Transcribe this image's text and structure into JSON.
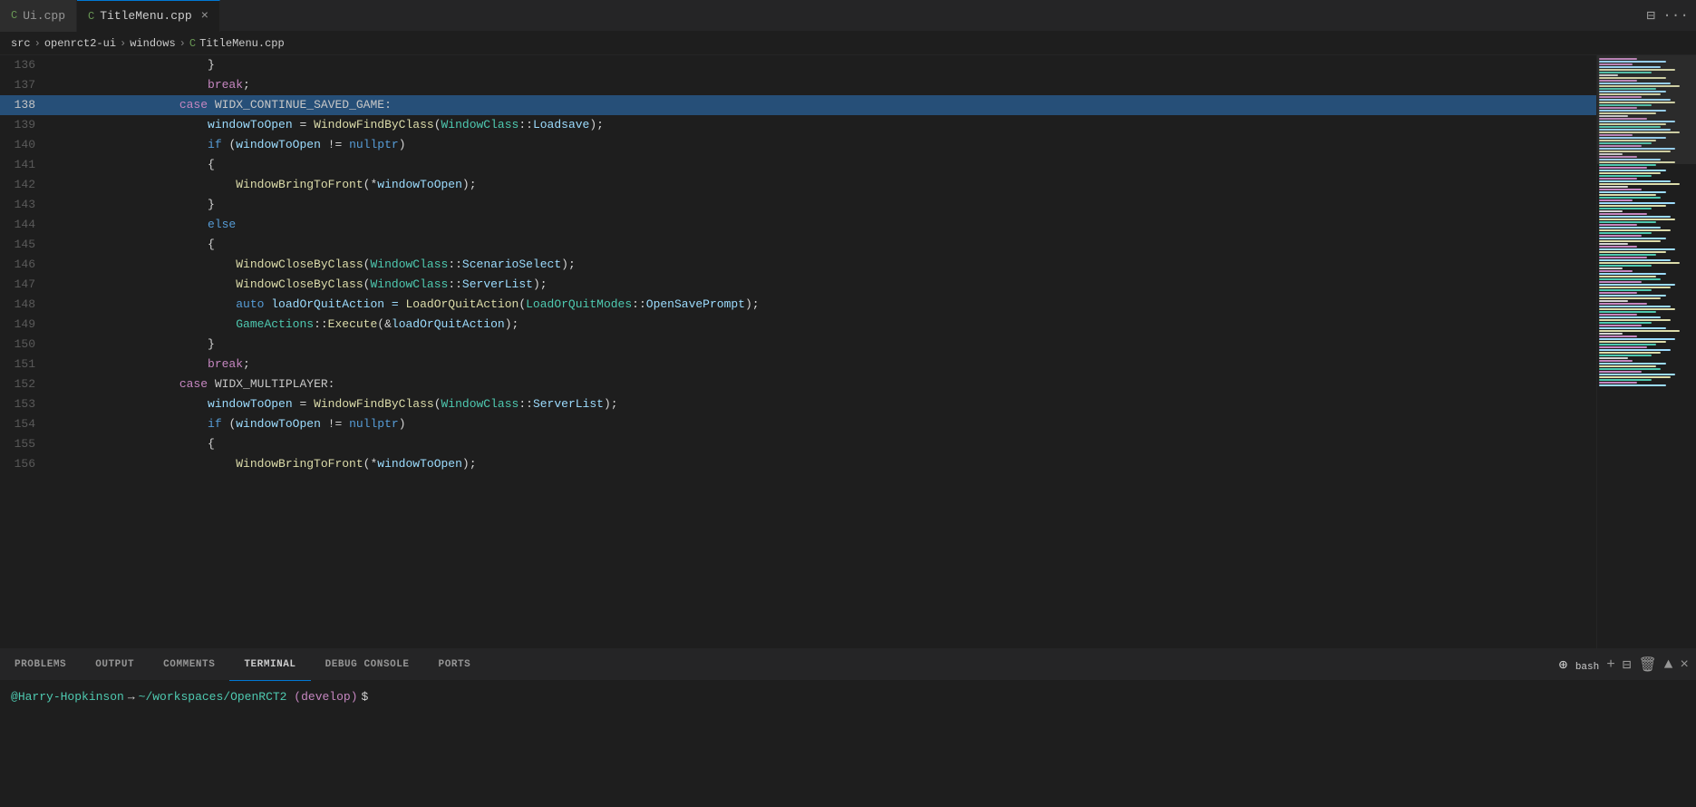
{
  "tabs": [
    {
      "id": "ui-cpp",
      "icon": "C",
      "label": "Ui.cpp",
      "active": false,
      "modified": false
    },
    {
      "id": "titlemenu-cpp",
      "icon": "C",
      "label": "TitleMenu.cpp",
      "active": true,
      "modified": false
    }
  ],
  "breadcrumb": {
    "parts": [
      "src",
      "openrct2-ui",
      "windows",
      "TitleMenu.cpp"
    ]
  },
  "lines": [
    {
      "num": 136,
      "active": false,
      "content": [
        {
          "t": "                    }",
          "c": "punct"
        }
      ]
    },
    {
      "num": 137,
      "active": false,
      "content": [
        {
          "t": "                    ",
          "c": "plain"
        },
        {
          "t": "break",
          "c": "kw"
        },
        {
          "t": ";",
          "c": "punct"
        }
      ]
    },
    {
      "num": 138,
      "active": true,
      "content": [
        {
          "t": "                ",
          "c": "plain"
        },
        {
          "t": "case",
          "c": "kw"
        },
        {
          "t": " WIDX_CONTINUE_SAVED_GAME:",
          "c": "macro"
        }
      ]
    },
    {
      "num": 139,
      "active": false,
      "content": [
        {
          "t": "                    ",
          "c": "plain"
        },
        {
          "t": "windowToOpen",
          "c": "var"
        },
        {
          "t": " = ",
          "c": "op"
        },
        {
          "t": "WindowFindByClass",
          "c": "fn"
        },
        {
          "t": "(",
          "c": "punct"
        },
        {
          "t": "WindowClass",
          "c": "cls"
        },
        {
          "t": "::",
          "c": "op"
        },
        {
          "t": "Loadsave",
          "c": "var"
        },
        {
          "t": ");",
          "c": "punct"
        }
      ]
    },
    {
      "num": 140,
      "active": false,
      "content": [
        {
          "t": "                    ",
          "c": "plain"
        },
        {
          "t": "if",
          "c": "kw2"
        },
        {
          "t": " (",
          "c": "punct"
        },
        {
          "t": "windowToOpen",
          "c": "var"
        },
        {
          "t": " != ",
          "c": "op"
        },
        {
          "t": "nullptr",
          "c": "kw2"
        },
        {
          "t": ")",
          "c": "punct"
        }
      ]
    },
    {
      "num": 141,
      "active": false,
      "content": [
        {
          "t": "                    {",
          "c": "punct"
        }
      ]
    },
    {
      "num": 142,
      "active": false,
      "content": [
        {
          "t": "                        ",
          "c": "plain"
        },
        {
          "t": "WindowBringToFront",
          "c": "fn"
        },
        {
          "t": "(*",
          "c": "op"
        },
        {
          "t": "windowToOpen",
          "c": "var"
        },
        {
          "t": ");",
          "c": "punct"
        }
      ]
    },
    {
      "num": 143,
      "active": false,
      "content": [
        {
          "t": "                    }",
          "c": "punct"
        }
      ]
    },
    {
      "num": 144,
      "active": false,
      "content": [
        {
          "t": "                    ",
          "c": "plain"
        },
        {
          "t": "else",
          "c": "kw2"
        }
      ]
    },
    {
      "num": 145,
      "active": false,
      "content": [
        {
          "t": "                    {",
          "c": "punct"
        }
      ]
    },
    {
      "num": 146,
      "active": false,
      "content": [
        {
          "t": "                        ",
          "c": "plain"
        },
        {
          "t": "WindowCloseByClass",
          "c": "fn"
        },
        {
          "t": "(",
          "c": "punct"
        },
        {
          "t": "WindowClass",
          "c": "cls"
        },
        {
          "t": "::",
          "c": "op"
        },
        {
          "t": "ScenarioSelect",
          "c": "var"
        },
        {
          "t": ");",
          "c": "punct"
        }
      ]
    },
    {
      "num": 147,
      "active": false,
      "content": [
        {
          "t": "                        ",
          "c": "plain"
        },
        {
          "t": "WindowCloseByClass",
          "c": "fn"
        },
        {
          "t": "(",
          "c": "punct"
        },
        {
          "t": "WindowClass",
          "c": "cls"
        },
        {
          "t": "::",
          "c": "op"
        },
        {
          "t": "ServerList",
          "c": "var"
        },
        {
          "t": ");",
          "c": "punct"
        }
      ]
    },
    {
      "num": 148,
      "active": false,
      "content": [
        {
          "t": "                        ",
          "c": "plain"
        },
        {
          "t": "auto",
          "c": "kw2"
        },
        {
          "t": " loadOrQuitAction = ",
          "c": "var"
        },
        {
          "t": "LoadOrQuitAction",
          "c": "fn"
        },
        {
          "t": "(",
          "c": "punct"
        },
        {
          "t": "LoadOrQuitModes",
          "c": "cls"
        },
        {
          "t": "::",
          "c": "op"
        },
        {
          "t": "OpenSavePrompt",
          "c": "var"
        },
        {
          "t": ");",
          "c": "punct"
        }
      ]
    },
    {
      "num": 149,
      "active": false,
      "content": [
        {
          "t": "                        ",
          "c": "plain"
        },
        {
          "t": "GameActions",
          "c": "cls"
        },
        {
          "t": "::",
          "c": "op"
        },
        {
          "t": "Execute",
          "c": "fn"
        },
        {
          "t": "(&",
          "c": "op"
        },
        {
          "t": "loadOrQuitAction",
          "c": "var"
        },
        {
          "t": ");",
          "c": "punct"
        }
      ]
    },
    {
      "num": 150,
      "active": false,
      "content": [
        {
          "t": "                    }",
          "c": "punct"
        }
      ]
    },
    {
      "num": 151,
      "active": false,
      "content": [
        {
          "t": "                    ",
          "c": "plain"
        },
        {
          "t": "break",
          "c": "kw"
        },
        {
          "t": ";",
          "c": "punct"
        }
      ]
    },
    {
      "num": 152,
      "active": false,
      "content": [
        {
          "t": "                ",
          "c": "plain"
        },
        {
          "t": "case",
          "c": "kw"
        },
        {
          "t": " WIDX_MULTIPLAYER:",
          "c": "macro"
        }
      ]
    },
    {
      "num": 153,
      "active": false,
      "content": [
        {
          "t": "                    ",
          "c": "plain"
        },
        {
          "t": "windowToOpen",
          "c": "var"
        },
        {
          "t": " = ",
          "c": "op"
        },
        {
          "t": "WindowFindByClass",
          "c": "fn"
        },
        {
          "t": "(",
          "c": "punct"
        },
        {
          "t": "WindowClass",
          "c": "cls"
        },
        {
          "t": "::",
          "c": "op"
        },
        {
          "t": "ServerList",
          "c": "var"
        },
        {
          "t": ");",
          "c": "punct"
        }
      ]
    },
    {
      "num": 154,
      "active": false,
      "content": [
        {
          "t": "                    ",
          "c": "plain"
        },
        {
          "t": "if",
          "c": "kw2"
        },
        {
          "t": " (",
          "c": "punct"
        },
        {
          "t": "windowToOpen",
          "c": "var"
        },
        {
          "t": " != ",
          "c": "op"
        },
        {
          "t": "nullptr",
          "c": "kw2"
        },
        {
          "t": ")",
          "c": "punct"
        }
      ]
    },
    {
      "num": 155,
      "active": false,
      "content": [
        {
          "t": "                    {",
          "c": "punct"
        }
      ]
    },
    {
      "num": 156,
      "active": false,
      "content": [
        {
          "t": "                        ",
          "c": "plain"
        },
        {
          "t": "WindowBringToFront",
          "c": "fn"
        },
        {
          "t": "(*",
          "c": "op"
        },
        {
          "t": "windowToOpen",
          "c": "var"
        },
        {
          "t": ");",
          "c": "punct"
        }
      ]
    }
  ],
  "bottom_panel": {
    "tabs": [
      {
        "id": "problems",
        "label": "PROBLEMS",
        "active": false
      },
      {
        "id": "output",
        "label": "OUTPUT",
        "active": false
      },
      {
        "id": "comments",
        "label": "COMMENTS",
        "active": false
      },
      {
        "id": "terminal",
        "label": "TERMINAL",
        "active": true
      },
      {
        "id": "debug-console",
        "label": "DEBUG CONSOLE",
        "active": false
      },
      {
        "id": "ports",
        "label": "PORTS",
        "active": false
      }
    ],
    "terminal": {
      "shell_label": "bash",
      "prompt": {
        "at": "@",
        "user": "Harry-Hopkinson",
        "arrow": "→",
        "path": "~/workspaces/OpenRCT2",
        "branch": "(develop)",
        "dollar": "$"
      }
    }
  },
  "window_actions": {
    "split_editor": "⊟",
    "more": "..."
  }
}
